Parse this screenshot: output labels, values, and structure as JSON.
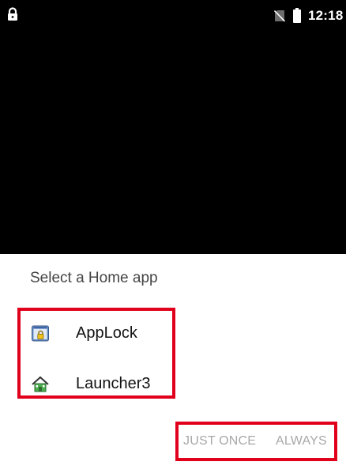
{
  "status_bar": {
    "time": "12:18",
    "icons": [
      "lock-icon",
      "no-sim-icon",
      "battery-icon"
    ]
  },
  "dialog": {
    "title": "Select a Home app",
    "apps": [
      {
        "label": "AppLock",
        "icon": "applock-icon"
      },
      {
        "label": "Launcher3",
        "icon": "home-icon"
      }
    ],
    "actions": {
      "just_once": "JUST ONCE",
      "always": "ALWAYS"
    }
  },
  "colors": {
    "highlight": "#e0001b",
    "disabled_text": "#a8a8a8",
    "background": "#000000",
    "sheet": "#ffffff"
  }
}
